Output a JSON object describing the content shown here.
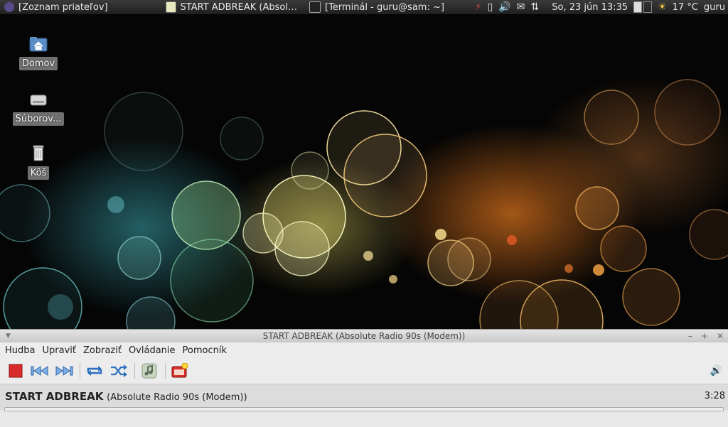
{
  "panel": {
    "tasks": [
      {
        "label": "[Zoznam priateľov]"
      },
      {
        "label": "START ADBREAK (Absolute ..."
      },
      {
        "label": "[Terminál - guru@sam: ~]"
      }
    ],
    "datetime": "So, 23 jún  13:35",
    "weather": "17 °C",
    "user": "guru"
  },
  "desktop": {
    "icons": [
      {
        "label": "Domov",
        "icon": "home-folder-icon"
      },
      {
        "label": "Súborov...",
        "icon": "drive-icon"
      },
      {
        "label": "Kôš",
        "icon": "trash-icon"
      }
    ]
  },
  "player": {
    "title": "START ADBREAK (Absolute Radio 90s (Modem))",
    "menu": [
      "Hudba",
      "Upraviť",
      "Zobraziť",
      "Ovládanie",
      "Pomocník"
    ],
    "song_title": "START ADBREAK",
    "song_subtitle": "(Absolute Radio 90s (Modem))",
    "time": "3:28"
  }
}
